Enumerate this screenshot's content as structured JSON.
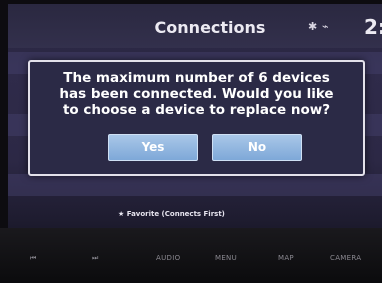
{
  "header": {
    "title": "Connections",
    "bluetooth_icon": "bluetooth-icon",
    "signal_icon": "signal-icon",
    "bluetooth_glyph": "✱",
    "signal_glyph": "⌁",
    "time_fragment": "2:"
  },
  "dialog": {
    "message_line1": "The maximum number of 6 devices",
    "message_line2": "has been connected. Would you like",
    "message_line3": "to choose a device to replace now?",
    "yes_label": "Yes",
    "no_label": "No"
  },
  "footer": {
    "favorite_note": "★ Favorite (Connects First)"
  },
  "hardware_buttons": {
    "prev": "⏮",
    "next": "⏭",
    "audio": "AUDIO",
    "menu": "MENU",
    "map": "MAP",
    "camera": "CAMERA"
  },
  "colors": {
    "button_blue": "#8fb3de",
    "dialog_bg": "#2b2a46",
    "text": "#ffffff"
  }
}
